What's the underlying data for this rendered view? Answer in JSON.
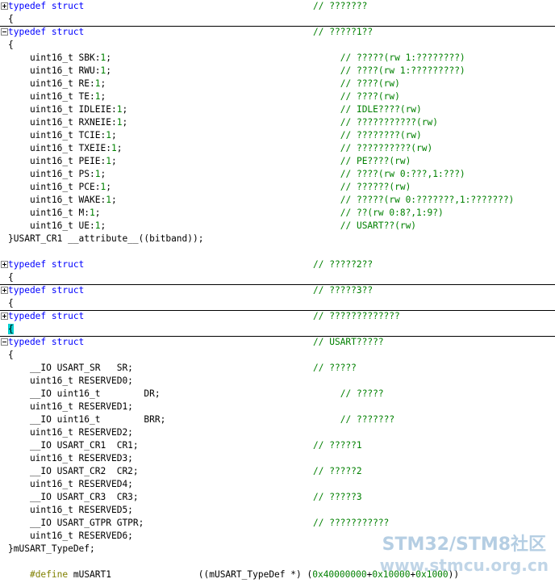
{
  "colors": {
    "keyword": "#0000ff",
    "comment": "#008000",
    "number": "#008000",
    "preprocessor": "#808000",
    "brace_highlight": "#00d0d0",
    "separator": "#000000",
    "watermark": "#96b9d7"
  },
  "lines": [
    {
      "fold": "plus",
      "sep": false,
      "parts": [
        [
          "kw",
          "typedef struct"
        ]
      ],
      "comment": "// ???????",
      "ccol": 56
    },
    {
      "fold": "none",
      "sep": false,
      "parts": [
        [
          "",
          "{"
        ]
      ],
      "comment": "",
      "ccol": 0
    },
    {
      "fold": "minus",
      "sep": true,
      "parts": [
        [
          "kw",
          "typedef struct"
        ]
      ],
      "comment": "// ?????1??",
      "ccol": 56
    },
    {
      "fold": "none",
      "sep": false,
      "parts": [
        [
          "",
          "{"
        ]
      ],
      "comment": "",
      "ccol": 0
    },
    {
      "fold": "none",
      "sep": false,
      "parts": [
        [
          "",
          "    uint16_t SBK:"
        ],
        [
          "num",
          "1"
        ],
        [
          "",
          ";"
        ]
      ],
      "comment": "// ?????(rw 1:????????)",
      "ccol": 61
    },
    {
      "fold": "none",
      "sep": false,
      "parts": [
        [
          "",
          "    uint16_t RWU:"
        ],
        [
          "num",
          "1"
        ],
        [
          "",
          ";"
        ]
      ],
      "comment": "// ????(rw 1:?????????)",
      "ccol": 61
    },
    {
      "fold": "none",
      "sep": false,
      "parts": [
        [
          "",
          "    uint16_t RE:"
        ],
        [
          "num",
          "1"
        ],
        [
          "",
          ";"
        ]
      ],
      "comment": "// ????(rw)",
      "ccol": 61
    },
    {
      "fold": "none",
      "sep": false,
      "parts": [
        [
          "",
          "    uint16_t TE:"
        ],
        [
          "num",
          "1"
        ],
        [
          "",
          ";"
        ]
      ],
      "comment": "// ????(rw)",
      "ccol": 61
    },
    {
      "fold": "none",
      "sep": false,
      "parts": [
        [
          "",
          "    uint16_t IDLEIE:"
        ],
        [
          "num",
          "1"
        ],
        [
          "",
          ";"
        ]
      ],
      "comment": "// IDLE????(rw)",
      "ccol": 61
    },
    {
      "fold": "none",
      "sep": false,
      "parts": [
        [
          "",
          "    uint16_t RXNEIE:"
        ],
        [
          "num",
          "1"
        ],
        [
          "",
          ";"
        ]
      ],
      "comment": "// ???????????(rw)",
      "ccol": 61
    },
    {
      "fold": "none",
      "sep": false,
      "parts": [
        [
          "",
          "    uint16_t TCIE:"
        ],
        [
          "num",
          "1"
        ],
        [
          "",
          ";"
        ]
      ],
      "comment": "// ????????(rw)",
      "ccol": 61
    },
    {
      "fold": "none",
      "sep": false,
      "parts": [
        [
          "",
          "    uint16_t TXEIE:"
        ],
        [
          "num",
          "1"
        ],
        [
          "",
          ";"
        ]
      ],
      "comment": "// ??????????(rw)",
      "ccol": 61
    },
    {
      "fold": "none",
      "sep": false,
      "parts": [
        [
          "",
          "    uint16_t PEIE:"
        ],
        [
          "num",
          "1"
        ],
        [
          "",
          ";"
        ]
      ],
      "comment": "// PE????(rw)",
      "ccol": 61
    },
    {
      "fold": "none",
      "sep": false,
      "parts": [
        [
          "",
          "    uint16_t PS:"
        ],
        [
          "num",
          "1"
        ],
        [
          "",
          ";"
        ]
      ],
      "comment": "// ????(rw 0:???,1:???)",
      "ccol": 61
    },
    {
      "fold": "none",
      "sep": false,
      "parts": [
        [
          "",
          "    uint16_t PCE:"
        ],
        [
          "num",
          "1"
        ],
        [
          "",
          ";"
        ]
      ],
      "comment": "// ??????(rw)",
      "ccol": 61
    },
    {
      "fold": "none",
      "sep": false,
      "parts": [
        [
          "",
          "    uint16_t WAKE:"
        ],
        [
          "num",
          "1"
        ],
        [
          "",
          ";"
        ]
      ],
      "comment": "// ?????(rw 0:???????,1:???????)",
      "ccol": 61
    },
    {
      "fold": "none",
      "sep": false,
      "parts": [
        [
          "",
          "    uint16_t M:"
        ],
        [
          "num",
          "1"
        ],
        [
          "",
          ";"
        ]
      ],
      "comment": "// ??(rw 0:8?,1:9?)",
      "ccol": 61
    },
    {
      "fold": "none",
      "sep": false,
      "parts": [
        [
          "",
          "    uint16_t UE:"
        ],
        [
          "num",
          "1"
        ],
        [
          "",
          ";"
        ]
      ],
      "comment": "// USART??(rw)",
      "ccol": 61
    },
    {
      "fold": "none",
      "sep": false,
      "parts": [
        [
          "",
          "}USART_CR1 __attribute__((bitband));"
        ]
      ],
      "comment": "",
      "ccol": 0
    },
    {
      "fold": "none",
      "sep": false,
      "parts": [
        [
          "",
          ""
        ]
      ],
      "comment": "",
      "ccol": 0
    },
    {
      "fold": "plus",
      "sep": false,
      "parts": [
        [
          "kw",
          "typedef struct"
        ]
      ],
      "comment": "// ?????2??",
      "ccol": 56
    },
    {
      "fold": "none",
      "sep": false,
      "parts": [
        [
          "",
          "{"
        ]
      ],
      "comment": "",
      "ccol": 0
    },
    {
      "fold": "plus",
      "sep": true,
      "parts": [
        [
          "kw",
          "typedef struct"
        ]
      ],
      "comment": "// ?????3??",
      "ccol": 56
    },
    {
      "fold": "none",
      "sep": false,
      "parts": [
        [
          "",
          "{"
        ]
      ],
      "comment": "",
      "ccol": 0
    },
    {
      "fold": "plus",
      "sep": true,
      "parts": [
        [
          "kw",
          "typedef struct"
        ]
      ],
      "comment": "// ?????????????",
      "ccol": 56
    },
    {
      "fold": "none",
      "sep": false,
      "parts": [
        [
          "hl",
          "{"
        ]
      ],
      "comment": "",
      "ccol": 0
    },
    {
      "fold": "minus",
      "sep": true,
      "parts": [
        [
          "kw",
          "typedef struct"
        ]
      ],
      "comment": "// USART?????",
      "ccol": 56
    },
    {
      "fold": "none",
      "sep": false,
      "parts": [
        [
          "",
          "{"
        ]
      ],
      "comment": "",
      "ccol": 0
    },
    {
      "fold": "none",
      "sep": false,
      "parts": [
        [
          "",
          "    __IO USART_SR   SR;"
        ]
      ],
      "comment": "// ?????",
      "ccol": 56
    },
    {
      "fold": "none",
      "sep": false,
      "parts": [
        [
          "",
          "    uint16_t RESERVED0;"
        ]
      ],
      "comment": "",
      "ccol": 0
    },
    {
      "fold": "none",
      "sep": false,
      "parts": [
        [
          "",
          "    __IO uint16_t        DR;"
        ]
      ],
      "comment": "// ?????",
      "ccol": 61
    },
    {
      "fold": "none",
      "sep": false,
      "parts": [
        [
          "",
          "    uint16_t RESERVED1;"
        ]
      ],
      "comment": "",
      "ccol": 0
    },
    {
      "fold": "none",
      "sep": false,
      "parts": [
        [
          "",
          "    __IO uint16_t        BRR;"
        ]
      ],
      "comment": "// ???????",
      "ccol": 61
    },
    {
      "fold": "none",
      "sep": false,
      "parts": [
        [
          "",
          "    uint16_t RESERVED2;"
        ]
      ],
      "comment": "",
      "ccol": 0
    },
    {
      "fold": "none",
      "sep": false,
      "parts": [
        [
          "",
          "    __IO USART_CR1  CR1;"
        ]
      ],
      "comment": "// ?????1",
      "ccol": 56
    },
    {
      "fold": "none",
      "sep": false,
      "parts": [
        [
          "",
          "    uint16_t RESERVED3;"
        ]
      ],
      "comment": "",
      "ccol": 0
    },
    {
      "fold": "none",
      "sep": false,
      "parts": [
        [
          "",
          "    __IO USART_CR2  CR2;"
        ]
      ],
      "comment": "// ?????2",
      "ccol": 56
    },
    {
      "fold": "none",
      "sep": false,
      "parts": [
        [
          "",
          "    uint16_t RESERVED4;"
        ]
      ],
      "comment": "",
      "ccol": 0
    },
    {
      "fold": "none",
      "sep": false,
      "parts": [
        [
          "",
          "    __IO USART_CR3  CR3;"
        ]
      ],
      "comment": "// ?????3",
      "ccol": 56
    },
    {
      "fold": "none",
      "sep": false,
      "parts": [
        [
          "",
          "    uint16_t RESERVED5;"
        ]
      ],
      "comment": "",
      "ccol": 0
    },
    {
      "fold": "none",
      "sep": false,
      "parts": [
        [
          "",
          "    __IO USART_GTPR GTPR;"
        ]
      ],
      "comment": "// ???????????",
      "ccol": 56
    },
    {
      "fold": "none",
      "sep": false,
      "parts": [
        [
          "",
          "    uint16_t RESERVED6;"
        ]
      ],
      "comment": "",
      "ccol": 0
    },
    {
      "fold": "none",
      "sep": false,
      "parts": [
        [
          "",
          "}mUSART_TypeDef;"
        ]
      ],
      "comment": "",
      "ccol": 0
    },
    {
      "fold": "none",
      "sep": false,
      "parts": [
        [
          "",
          ""
        ]
      ],
      "comment": "",
      "ccol": 0
    },
    {
      "fold": "none",
      "sep": false,
      "parts": [
        [
          "",
          "    "
        ],
        [
          "pre",
          "#define"
        ],
        [
          "",
          " mUSART1                ((mUSART_TypeDef *) ("
        ],
        [
          "num",
          "0x40000000"
        ],
        [
          "",
          "+"
        ],
        [
          "num",
          "0x10000"
        ],
        [
          "",
          "+"
        ],
        [
          "num",
          "0x1000"
        ],
        [
          "",
          "))"
        ]
      ],
      "comment": "",
      "ccol": 0
    }
  ],
  "watermark": {
    "title": "STM32/STM8社区",
    "url": "www.stmcu.org.cn"
  }
}
